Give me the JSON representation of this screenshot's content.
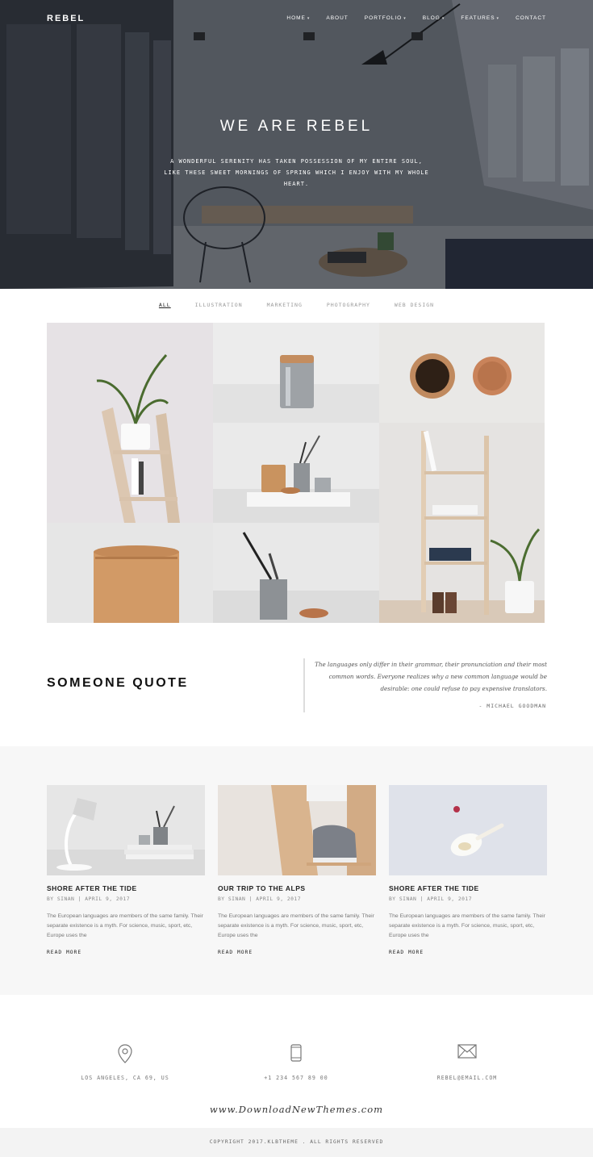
{
  "header": {
    "logo": "REBEL",
    "nav": [
      {
        "label": "HOME",
        "dropdown": true
      },
      {
        "label": "ABOUT",
        "dropdown": false
      },
      {
        "label": "PORTFOLIO",
        "dropdown": true
      },
      {
        "label": "BLOG",
        "dropdown": true
      },
      {
        "label": "FEATURES",
        "dropdown": true
      },
      {
        "label": "CONTACT",
        "dropdown": false
      }
    ]
  },
  "hero": {
    "title": "WE ARE REBEL",
    "subtitle": "A WONDERFUL SERENITY HAS TAKEN POSSESSION OF MY ENTIRE SOUL, LIKE THESE SWEET MORNINGS OF SPRING WHICH I ENJOY WITH MY WHOLE HEART."
  },
  "portfolio": {
    "filters": [
      "ALL",
      "ILLUSTRATION",
      "MARKETING",
      "PHOTOGRAPHY",
      "WEB DESIGN"
    ],
    "active_filter": "ALL"
  },
  "quote": {
    "title": "SOMEONE QUOTE",
    "text": "The languages only differ in their grammar, their pronunciation and their most common words. Everyone realizes why a new common language would be desirable: one could refuse to pay expensive translators.",
    "author": "- MICHAEL GOODMAN"
  },
  "blog": {
    "posts": [
      {
        "title": "SHORE AFTER THE TIDE",
        "by": "BY",
        "author": "SINAN",
        "date": "APRIL 9, 2017",
        "excerpt": "The European languages are members of the same family. Their separate existence is a myth. For science, music, sport, etc, Europe uses the",
        "read_more": "READ MORE"
      },
      {
        "title": "OUR TRIP TO THE ALPS",
        "by": "BY",
        "author": "SINAN",
        "date": "APRIL 9, 2017",
        "excerpt": "The European languages are members of the same family. Their separate existence is a myth. For science, music, sport, etc, Europe uses the",
        "read_more": "READ MORE"
      },
      {
        "title": "SHORE AFTER THE TIDE",
        "by": "BY",
        "author": "SINAN",
        "date": "APRIL 9, 2017",
        "excerpt": "The European languages are members of the same family. Their separate existence is a myth. For science, music, sport, etc, Europe uses the",
        "read_more": "READ MORE"
      }
    ]
  },
  "contact": {
    "address": "LOS ANGELES, CA 69, US",
    "phone": "+1 234 567 89 00",
    "email": "REBEL@EMAIL.COM",
    "icons": [
      "map-pin-icon",
      "phone-icon",
      "envelope-icon"
    ]
  },
  "watermark": "www.DownloadNewThemes.com",
  "footer": {
    "copyright": "COPYRIGHT 2017.KLBTHEME . ALL RIGHTS RESERVED"
  },
  "colors": {
    "hero_overlay": "#2b3038",
    "blog_bg": "#f7f7f7",
    "footer_bg": "#f3f3f3",
    "text_dark": "#222222",
    "text_muted": "#888888"
  }
}
